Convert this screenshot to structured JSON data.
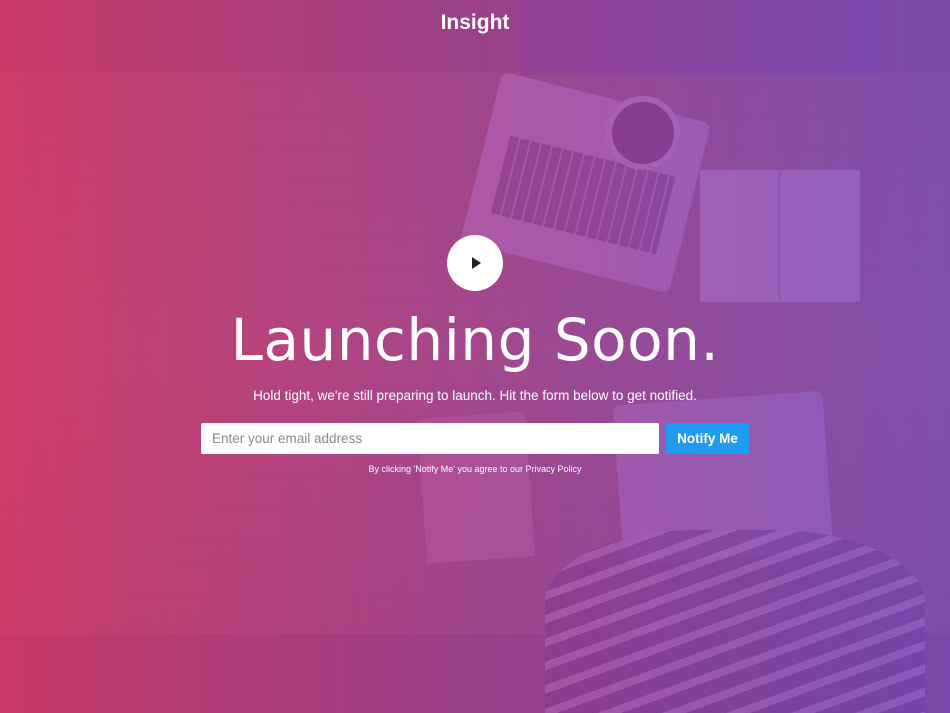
{
  "brand": {
    "name": "Insight"
  },
  "hero": {
    "play_icon": "play-icon",
    "headline": "Launching Soon.",
    "subtext": "Hold tight, we're still preparing to launch. Hit the form below to get notified."
  },
  "signup": {
    "email_placeholder": "Enter your email address",
    "email_value": "",
    "button_label": "Notify Me",
    "disclaimer": "By clicking 'Notify Me' you agree to our Privacy Policy"
  },
  "colors": {
    "overlay_left": "#d6376e",
    "overlay_right": "#7a4abe",
    "button": "#1f9cf0",
    "text": "#ffffff"
  }
}
